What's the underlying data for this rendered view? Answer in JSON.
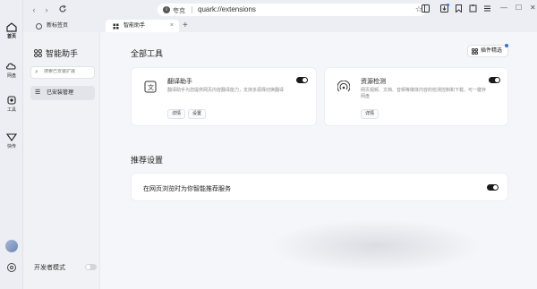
{
  "leftbar": {
    "items": [
      {
        "label": "首页",
        "icon": "home-icon"
      },
      {
        "label": "网盘",
        "icon": "cloud-icon"
      },
      {
        "label": "工具",
        "icon": "tool-icon"
      },
      {
        "label": "快传",
        "icon": "send-icon"
      }
    ],
    "bottom_icons": [
      "avatar",
      "settings-icon"
    ]
  },
  "topbar": {
    "url_site": "夸克",
    "url": "quark://extensions"
  },
  "tabs": [
    {
      "label": "新标签页",
      "active": false
    },
    {
      "label": "智能助手",
      "active": true
    }
  ],
  "sidepanel": {
    "title": "智能助手",
    "search_placeholder": "搜索已安装扩展",
    "item": "已安装管理",
    "dev_mode": "开发者模式",
    "dev_mode_on": false
  },
  "main": {
    "all_tools_heading": "全部工具",
    "fine_button": "插件精选",
    "cards": [
      {
        "name": "翻译助手",
        "desc_line1": "翻译助手为您提供网页内容翻译能力，支持多源择切换翻译",
        "desc_line2": "",
        "enabled": true,
        "buttons": [
          "详情",
          "设置"
        ],
        "icon": "translate-icon"
      },
      {
        "name": "资源检测",
        "desc_line1": "网页视频、文档、音频等媒体内容的检测控制和下载，可一键存",
        "desc_line2": "网盘",
        "enabled": true,
        "buttons": [
          "详情"
        ],
        "icon": "broadcast-icon"
      }
    ],
    "rec_heading": "推荐设置",
    "rec_item": "在网页浏览时为你智能推荐服务",
    "rec_enabled": true
  },
  "colors": {
    "accent_dark": "#1a1a1a",
    "badge_blue": "#2f6ef5"
  }
}
